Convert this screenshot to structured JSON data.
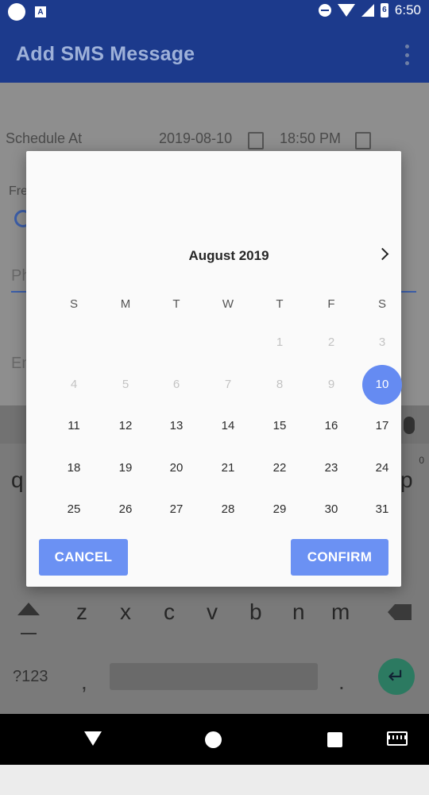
{
  "status_bar": {
    "time": "6:50",
    "battery_label": "6"
  },
  "app_bar": {
    "title": "Add SMS Message"
  },
  "form": {
    "schedule_label": "Schedule At",
    "date_value": "2019-08-10",
    "time_value": "18:50 PM",
    "frequency_label_partial": "Fre",
    "phone_hint_partial": "Ph",
    "message_hint_partial": "En"
  },
  "keyboard": {
    "row_partial": [
      "q",
      "p"
    ],
    "bottom_row": [
      "z",
      "x",
      "c",
      "v",
      "b",
      "n",
      "m"
    ],
    "symbols_key": "?123",
    "comma": ",",
    "period": ".",
    "zero_hint": "0"
  },
  "dialog": {
    "month_label": "August 2019",
    "weekdays": [
      "S",
      "M",
      "T",
      "W",
      "T",
      "F",
      "S"
    ],
    "weeks": [
      [
        "",
        "",
        "",
        "",
        "1",
        "2",
        "3"
      ],
      [
        "4",
        "5",
        "6",
        "7",
        "8",
        "9",
        "10"
      ],
      [
        "11",
        "12",
        "13",
        "14",
        "15",
        "16",
        "17"
      ],
      [
        "18",
        "19",
        "20",
        "21",
        "22",
        "23",
        "24"
      ],
      [
        "25",
        "26",
        "27",
        "28",
        "29",
        "30",
        "31"
      ]
    ],
    "selected_day": "10",
    "muted_days": [
      "1",
      "2",
      "3",
      "4",
      "5",
      "6",
      "7",
      "8",
      "9"
    ],
    "cancel_label": "CANCEL",
    "confirm_label": "CONFIRM"
  },
  "colors": {
    "primary": "#1c3a8c",
    "accent": "#658bf2",
    "button": "#6b91f3"
  }
}
